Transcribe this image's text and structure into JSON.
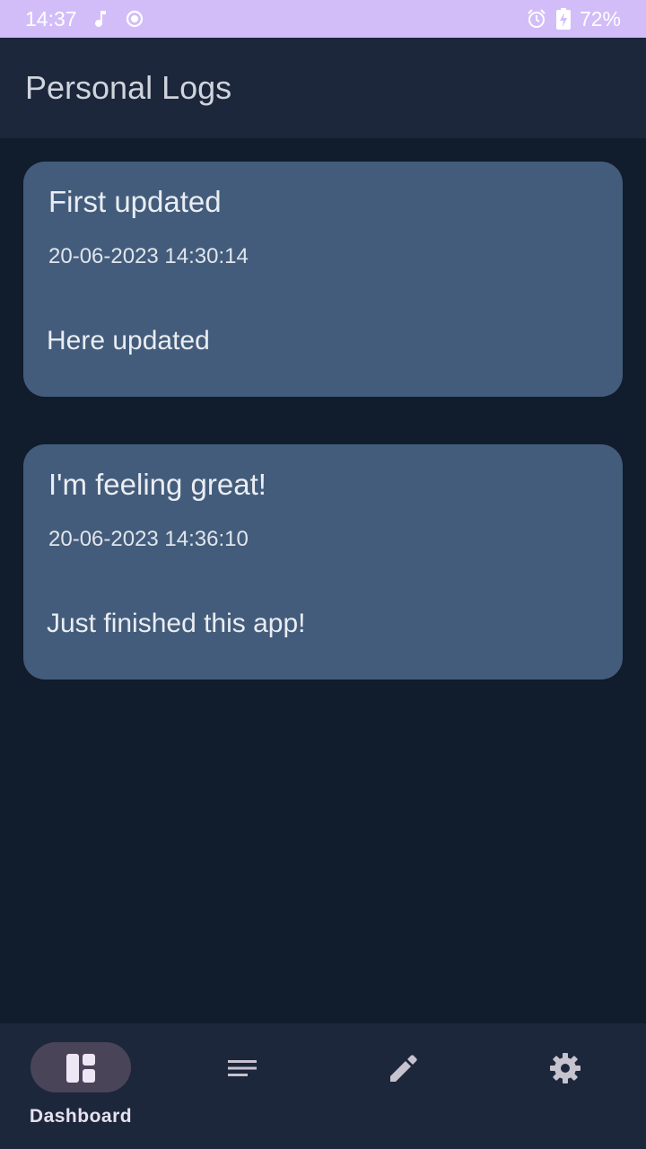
{
  "status_bar": {
    "time": "14:37",
    "battery": "72%",
    "icons": [
      "music-note-icon",
      "record-icon",
      "alarm-icon",
      "battery-charging-icon"
    ]
  },
  "app_bar": {
    "title": "Personal Logs"
  },
  "logs": [
    {
      "title": "First updated",
      "date": "20-06-2023 14:30:14",
      "body": "Here updated"
    },
    {
      "title": "I'm feeling great!",
      "date": "20-06-2023 14:36:10",
      "body": "Just finished this app!"
    }
  ],
  "bottom_nav": {
    "items": [
      {
        "label": "Dashboard",
        "icon": "dashboard-icon",
        "selected": true
      },
      {
        "label": "",
        "icon": "list-icon",
        "selected": false
      },
      {
        "label": "",
        "icon": "edit-icon",
        "selected": false
      },
      {
        "label": "",
        "icon": "settings-icon",
        "selected": false
      }
    ]
  },
  "colors": {
    "status_bar": "#d2bdf9",
    "app_bar": "#1d273b",
    "background": "#111c2c",
    "card": "#435c7b",
    "nav_pill": "#4a4458"
  }
}
